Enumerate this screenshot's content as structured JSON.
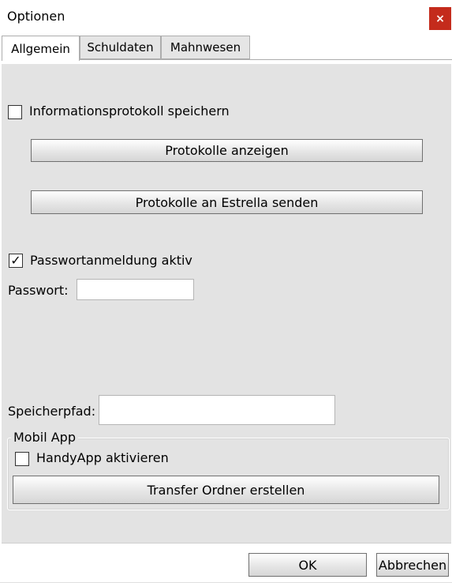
{
  "window": {
    "title": "Optionen",
    "close_label": "×"
  },
  "tabs": [
    {
      "label": "Allgemein",
      "active": true
    },
    {
      "label": "Schuldaten",
      "active": false
    },
    {
      "label": "Mahnwesen",
      "active": false
    }
  ],
  "general": {
    "info_log_label": "Informationsprotokoll speichern",
    "info_log_checked": false,
    "show_logs_button": "Protokolle anzeigen",
    "send_logs_button": "Protokolle an Estrella senden",
    "password_login_label": "Passwortanmeldung aktiv",
    "password_login_checked": true,
    "checkmark": "✓",
    "password_label": "Passwort:",
    "password_value": "",
    "storage_path_label": "Speicherpfad:",
    "storage_path_value": ""
  },
  "mobile_app": {
    "group_label": "Mobil App",
    "handy_app_label": "HandyApp aktivieren",
    "handy_app_checked": false,
    "transfer_button": "Transfer Ordner erstellen"
  },
  "footer": {
    "ok_label": "OK",
    "cancel_label": "Abbrechen"
  }
}
